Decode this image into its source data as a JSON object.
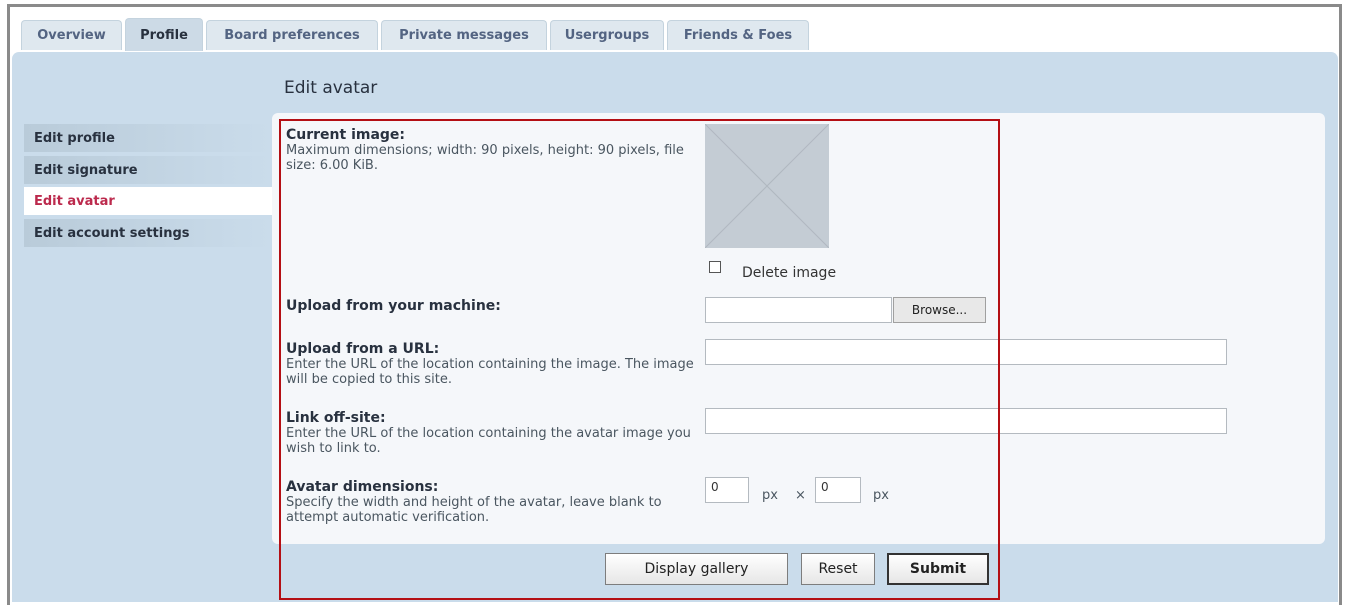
{
  "tabs": [
    "Overview",
    "Profile",
    "Board preferences",
    "Private messages",
    "Usergroups",
    "Friends & Foes"
  ],
  "page_title": "Edit avatar",
  "menu": [
    "Edit profile",
    "Edit signature",
    "Edit avatar",
    "Edit account settings"
  ],
  "current_image": {
    "label": "Current image:",
    "desc": "Maximum dimensions; width: 90 pixels, height: 90 pixels, file size: 6.00 KiB."
  },
  "delete_label": "Delete image",
  "upload_machine": {
    "label": "Upload from your machine:",
    "button": "Browse..."
  },
  "upload_url": {
    "label": "Upload from a URL:",
    "desc": "Enter the URL of the location containing the image. The image will be copied to this site."
  },
  "link_offsite": {
    "label": "Link off-site:",
    "desc": "Enter the URL of the location containing the avatar image you wish to link to."
  },
  "dimensions": {
    "label": "Avatar dimensions:",
    "desc": "Specify the width and height of the avatar, leave blank to attempt automatic verification.",
    "width": "0",
    "height": "0",
    "unit": "px",
    "sep": "×"
  },
  "buttons": {
    "gallery": "Display gallery",
    "reset": "Reset",
    "submit": "Submit"
  },
  "colors": {
    "panel": "#cadceb",
    "active_menu_text": "#bc2a4d",
    "highlight_border": "#b40f14"
  }
}
